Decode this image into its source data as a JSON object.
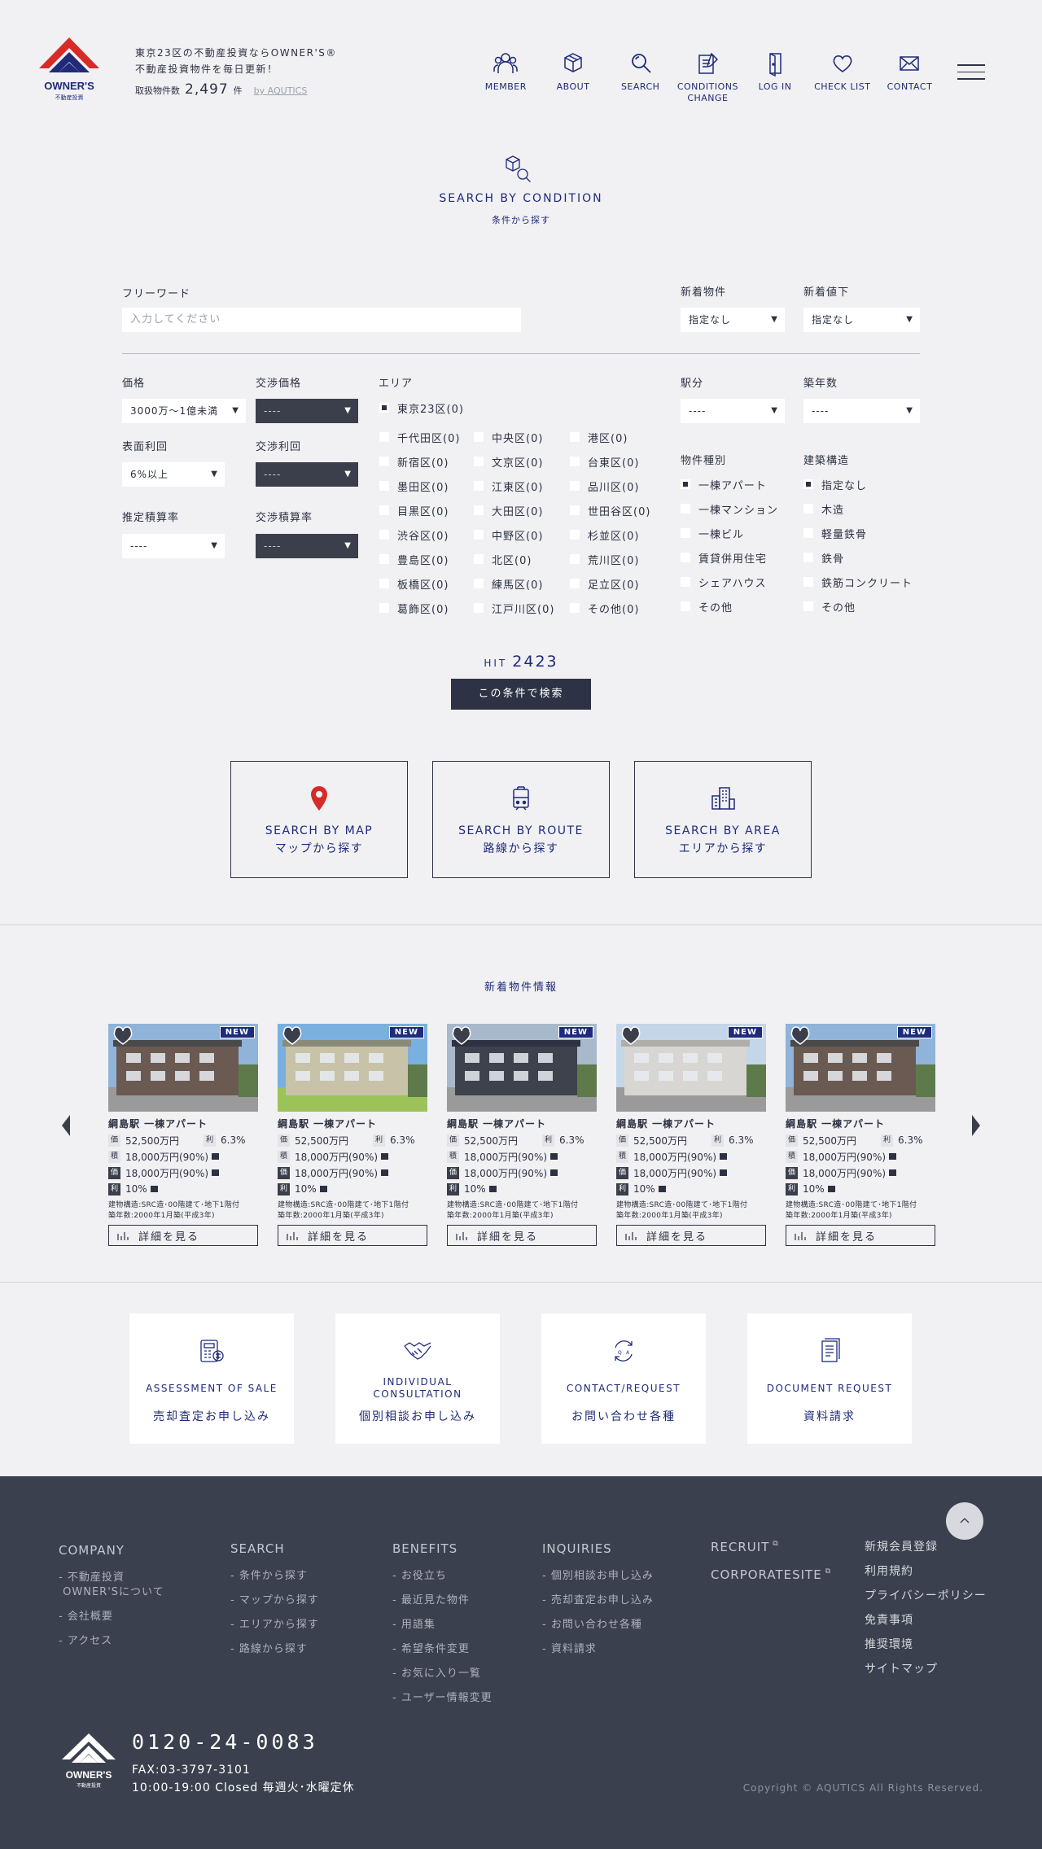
{
  "header": {
    "logo_text": "OWNER'S",
    "logo_sub": "不動産投資",
    "tagline_1": "東京23区の不動産投資ならOWNER'S®",
    "tagline_2": "不動産投資物件を毎日更新！",
    "count_label": "取扱物件数",
    "count_value": "2,497",
    "count_unit": "件",
    "by": "by AQUTICS",
    "nav": [
      {
        "label": "MEMBER",
        "icon": "member-icon"
      },
      {
        "label": "ABOUT",
        "icon": "cube-icon"
      },
      {
        "label": "SEARCH",
        "icon": "search-icon"
      },
      {
        "label": "CONDITIONS\nCHANGE",
        "icon": "conditions-icon"
      },
      {
        "label": "LOG IN",
        "icon": "login-icon"
      },
      {
        "label": "CHECK LIST",
        "icon": "heart-icon"
      },
      {
        "label": "CONTACT",
        "icon": "mail-icon"
      }
    ]
  },
  "section": {
    "title": "SEARCH BY CONDITION",
    "sub": "条件から探す"
  },
  "form": {
    "freeword_label": "フリーワード",
    "freeword_placeholder": "入力してください",
    "new_label": "新着物件",
    "new_value": "指定なし",
    "price_drop_label": "新着値下",
    "price_drop_value": "指定なし",
    "price_label": "価格",
    "price_value": "3000万〜1億未満",
    "nego_price_label": "交渉価格",
    "nego_price_value": "----",
    "yield_label": "表面利回",
    "yield_value": "6%以上",
    "nego_yield_label": "交渉利回",
    "nego_yield_value": "----",
    "est_label": "推定積算率",
    "est_value": "----",
    "nego_est_label": "交渉積算率",
    "nego_est_value": "----",
    "area_label": "エリア",
    "area_main": "東京23区(0)",
    "areas": [
      [
        "千代田区(0)",
        "中央区(0)",
        "港区(0)"
      ],
      [
        "新宿区(0)",
        "文京区(0)",
        "台東区(0)"
      ],
      [
        "墨田区(0)",
        "江東区(0)",
        "品川区(0)"
      ],
      [
        "目黒区(0)",
        "大田区(0)",
        "世田谷区(0)"
      ],
      [
        "渋谷区(0)",
        "中野区(0)",
        "杉並区(0)"
      ],
      [
        "豊島区(0)",
        "北区(0)",
        "荒川区(0)"
      ],
      [
        "板橋区(0)",
        "練馬区(0)",
        "足立区(0)"
      ],
      [
        "葛飾区(0)",
        "江戸川区(0)",
        "その他(0)"
      ]
    ],
    "walk_label": "駅分",
    "walk_value": "----",
    "age_label": "築年数",
    "age_value": "----",
    "type_label": "物件種別",
    "types": [
      "一棟アパート",
      "一棟マンション",
      "一棟ビル",
      "賃貸併用住宅",
      "シェアハウス",
      "その他"
    ],
    "struct_label": "建築構造",
    "structs": [
      "指定なし",
      "木造",
      "軽量鉄骨",
      "鉄骨",
      "鉄筋コンクリート",
      "その他"
    ],
    "hit_label": "HIT",
    "hit_value": "2423",
    "search_button": "この条件で検索"
  },
  "search_boxes": [
    {
      "en": "SEARCH BY MAP",
      "jp": "マップから探す",
      "icon": "map-pin-icon"
    },
    {
      "en": "SEARCH BY ROUTE",
      "jp": "路線から探す",
      "icon": "train-icon"
    },
    {
      "en": "SEARCH BY AREA",
      "jp": "エリアから探す",
      "icon": "building-icon"
    }
  ],
  "new_section_title": "新着物件情報",
  "cards": [
    {
      "badge": "NEW",
      "name": "綱島駅 一棟アパート",
      "price_tag": "価",
      "price": "52,500万円",
      "yield_tag": "利",
      "yield": "6.3%",
      "est_tag": "積",
      "est": "18,000万円(90%)",
      "nego_tag": "価",
      "nego": "18,000万円(90%)",
      "nego_yield_tag": "利",
      "nego_yield": "10%",
      "desc_1": "建物構造:SRC造･00階建て･地下1階付",
      "desc_2": "築年数:2000年1月築(平成3年)",
      "detail": "詳細を見る"
    },
    {
      "badge": "NEW",
      "name": "綱島駅 一棟アパート",
      "price_tag": "価",
      "price": "52,500万円",
      "yield_tag": "利",
      "yield": "6.3%",
      "est_tag": "積",
      "est": "18,000万円(90%)",
      "nego_tag": "価",
      "nego": "18,000万円(90%)",
      "nego_yield_tag": "利",
      "nego_yield": "10%",
      "desc_1": "建物構造:SRC造･00階建て･地下1階付",
      "desc_2": "築年数:2000年1月築(平成3年)",
      "detail": "詳細を見る"
    },
    {
      "badge": "NEW",
      "name": "綱島駅 一棟アパート",
      "price_tag": "価",
      "price": "52,500万円",
      "yield_tag": "利",
      "yield": "6.3%",
      "est_tag": "積",
      "est": "18,000万円(90%)",
      "nego_tag": "価",
      "nego": "18,000万円(90%)",
      "nego_yield_tag": "利",
      "nego_yield": "10%",
      "desc_1": "建物構造:SRC造･00階建て･地下1階付",
      "desc_2": "築年数:2000年1月築(平成3年)",
      "detail": "詳細を見る"
    },
    {
      "badge": "NEW",
      "name": "綱島駅 一棟アパート",
      "price_tag": "価",
      "price": "52,500万円",
      "yield_tag": "利",
      "yield": "6.3%",
      "est_tag": "積",
      "est": "18,000万円(90%)",
      "nego_tag": "価",
      "nego": "18,000万円(90%)",
      "nego_yield_tag": "利",
      "nego_yield": "10%",
      "desc_1": "建物構造:SRC造･00階建て･地下1階付",
      "desc_2": "築年数:2000年1月築(平成3年)",
      "detail": "詳細を見る"
    },
    {
      "badge": "NEW",
      "name": "綱島駅 一棟アパート",
      "price_tag": "価",
      "price": "52,500万円",
      "yield_tag": "利",
      "yield": "6.3%",
      "est_tag": "積",
      "est": "18,000万円(90%)",
      "nego_tag": "価",
      "nego": "18,000万円(90%)",
      "nego_yield_tag": "利",
      "nego_yield": "10%",
      "desc_1": "建物構造:SRC造･00階建て･地下1階付",
      "desc_2": "築年数:2000年1月築(平成3年)",
      "detail": "詳細を見る"
    }
  ],
  "tiles": [
    {
      "en": "ASSESSMENT OF SALE",
      "jp": "売却査定お申し込み",
      "icon": "calculator-icon"
    },
    {
      "en": "INDIVIDUAL\nCONSULTATION",
      "jp": "個別相談お申し込み",
      "icon": "handshake-icon"
    },
    {
      "en": "CONTACT/REQUEST",
      "jp": "お問い合わせ各種",
      "icon": "exchange-icon"
    },
    {
      "en": "DOCUMENT REQUEST",
      "jp": "資料請求",
      "icon": "document-icon"
    }
  ],
  "footer": {
    "company": {
      "title": "COMPANY",
      "links": [
        "- 不動産投資\n OWNER'Sについて",
        "- 会社概要",
        "- アクセス"
      ]
    },
    "search": {
      "title": "SEARCH",
      "links": [
        "- 条件から探す",
        "- マップから探す",
        "- エリアから探す",
        "- 路線から探す"
      ]
    },
    "benefits": {
      "title": "BENEFITS",
      "links": [
        "- お役立ち",
        "- 最近見た物件",
        "- 用語集",
        "- 希望条件変更",
        "- お気に入り一覧",
        "- ユーザー情報変更"
      ]
    },
    "inquiries": {
      "title": "INQUIRIES",
      "links": [
        "- 個別相談お申し込み",
        "- 売却査定お申し込み",
        "- お問い合わせ各種",
        "- 資料請求"
      ]
    },
    "recruit": "RECRUIT",
    "corporate": "CORPORATESITE",
    "misc": [
      "新規会員登録",
      "利用規約",
      "プライバシーポリシー",
      "免責事項",
      "推奨環境",
      "サイトマップ"
    ],
    "phone": "0120-24-0083",
    "fax": "FAX:03-3797-3101",
    "hours": "10:00-19:00  Closed 毎週火･水曜定休",
    "copyright": "Copyright © AQUTICS All Rights Reserved."
  },
  "colors": {
    "navy": "#1f2a7a",
    "logo_red": "#d62b26",
    "footer_bg": "#3b404e"
  }
}
